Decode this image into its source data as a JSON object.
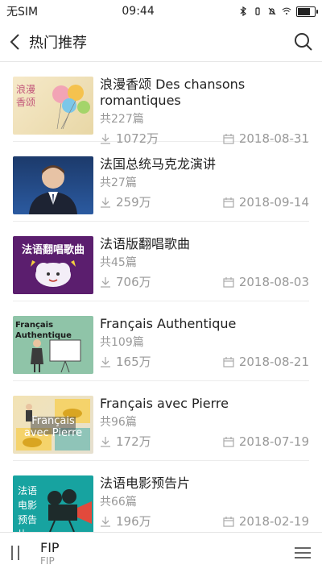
{
  "status": {
    "carrier": "无SIM",
    "time": "09:44",
    "battery_level": 0.7
  },
  "nav": {
    "title": "热门推荐"
  },
  "items": [
    {
      "thumb_text": "浪漫香颂",
      "title": "浪漫香颂 Des chansons romantiques",
      "count": "共227篇",
      "downloads": "1072万",
      "date": "2018-08-31"
    },
    {
      "thumb_text": "",
      "title": "法国总统马克龙演讲",
      "count": "共27篇",
      "downloads": "259万",
      "date": "2018-09-14"
    },
    {
      "thumb_text": "法语翻唱歌曲",
      "title": "法语版翻唱歌曲",
      "count": "共45篇",
      "downloads": "706万",
      "date": "2018-08-03"
    },
    {
      "thumb_text": "Français Authentique",
      "title": "Français Authentique",
      "count": "共109篇",
      "downloads": "165万",
      "date": "2018-08-21"
    },
    {
      "thumb_text": "Français avec Pierre",
      "title": "Français avec Pierre",
      "count": "共96篇",
      "downloads": "172万",
      "date": "2018-07-19"
    },
    {
      "thumb_text": "法语电影预告片",
      "title": "法语电影预告片",
      "count": "共66篇",
      "downloads": "196万",
      "date": "2018-02-19"
    }
  ],
  "player": {
    "title": "FIP",
    "subtitle": "FIP"
  }
}
